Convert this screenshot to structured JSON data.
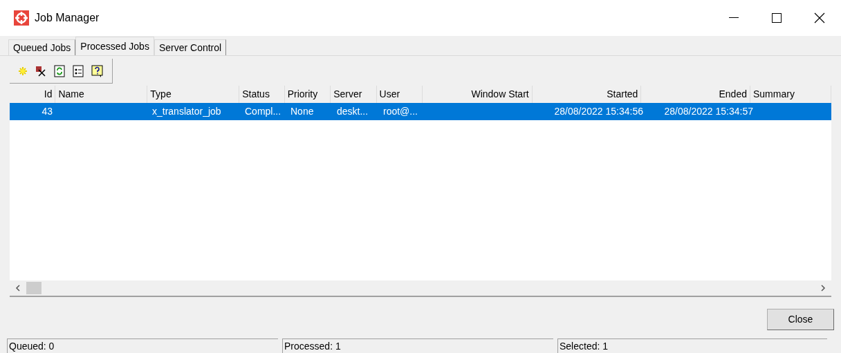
{
  "window": {
    "title": "Job Manager"
  },
  "tabs": [
    {
      "label": "Queued Jobs",
      "selected": false
    },
    {
      "label": "Processed Jobs",
      "selected": true
    },
    {
      "label": "Server Control",
      "selected": false
    }
  ],
  "table": {
    "columns": [
      "Id",
      "Name",
      "Type",
      "Status",
      "Priority",
      "Server",
      "User",
      "Window Start",
      "Started",
      "Ended",
      "Summary"
    ],
    "rows": [
      {
        "selected": true,
        "cells": [
          "43",
          "",
          "x_translator_job",
          "Compl...",
          "None",
          "deskt...",
          "root@...",
          "",
          "28/08/2022 15:34:56",
          "28/08/2022 15:34:57",
          ""
        ]
      }
    ]
  },
  "buttons": [
    "Close"
  ],
  "status_bar": [
    "Queued: 0",
    "Processed: 1",
    "Selected: 1"
  ]
}
